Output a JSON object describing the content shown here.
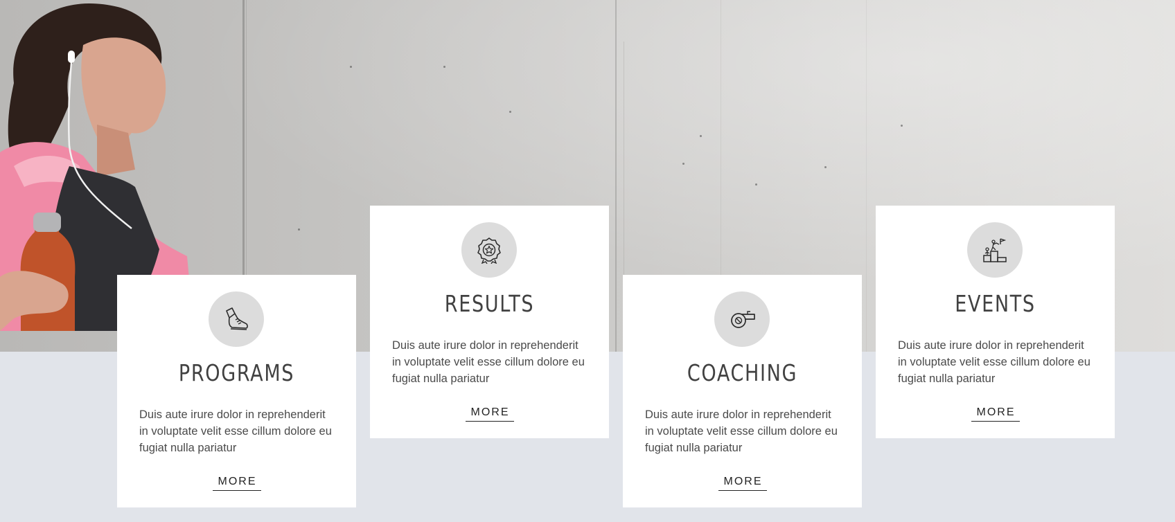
{
  "hero": {
    "image": "woman-runner-concrete-wall"
  },
  "cards": [
    {
      "icon": "running-shoe-icon",
      "title": "PROGRAMS",
      "description": "Duis aute irure dolor in reprehenderit in voluptate velit esse cillum dolore eu fugiat nulla pariatur",
      "more_label": "MORE"
    },
    {
      "icon": "award-badge-icon",
      "title": "RESULTS",
      "description": "Duis aute irure dolor in reprehenderit in voluptate velit esse cillum dolore eu fugiat nulla pariatur",
      "more_label": "MORE"
    },
    {
      "icon": "whistle-icon",
      "title": "COACHING",
      "description": "Duis aute irure dolor in reprehenderit in voluptate velit esse cillum dolore eu fugiat nulla pariatur",
      "more_label": "MORE"
    },
    {
      "icon": "podium-icon",
      "title": "EVENTS",
      "description": "Duis aute irure dolor in reprehenderit in voluptate velit esse cillum dolore eu fugiat nulla pariatur",
      "more_label": "MORE"
    }
  ],
  "colors": {
    "page_background": "#e1e4ea",
    "card_background": "#ffffff",
    "icon_circle": "#dcdcdc",
    "title_text": "#414141",
    "body_text": "#4a4a4a"
  }
}
